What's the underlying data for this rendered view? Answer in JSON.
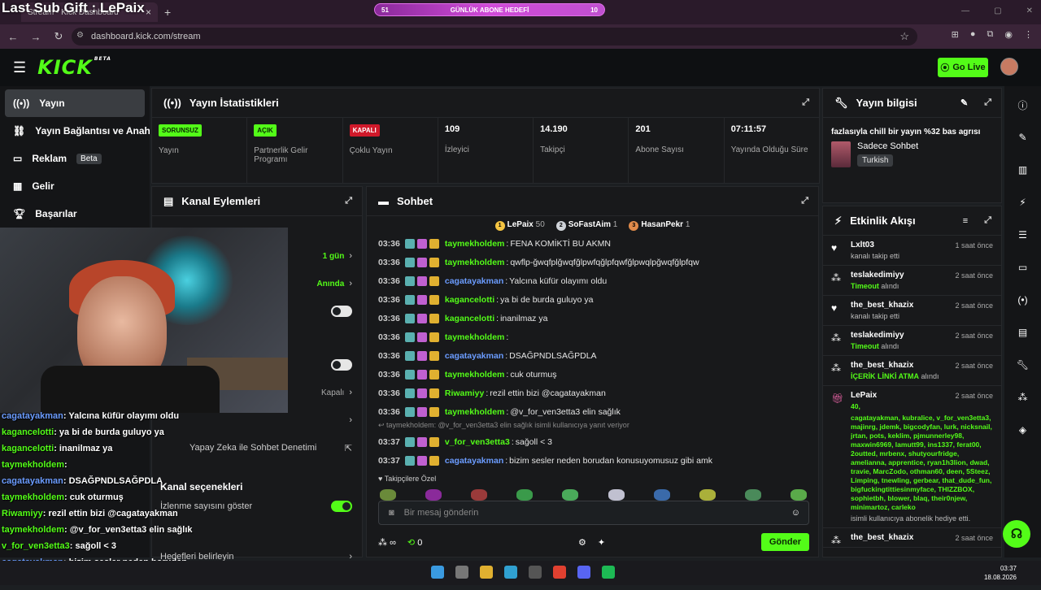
{
  "overlay_title": "Last Sub Gift : LePaix",
  "browser": {
    "tab_title": "Stream - Kick Dashboard",
    "new_tab": "+",
    "goal_left": "51",
    "goal_label": "GÜNLÜK ABONE HEDEFİ",
    "goal_right": "10",
    "url": "dashboard.kick.com/stream"
  },
  "header": {
    "logo": "KICK",
    "logo_badge": "BETA",
    "go_live": "Go Live"
  },
  "nav": {
    "items": [
      {
        "label": "Yayın",
        "icon": "stream-icon"
      },
      {
        "label": "Yayın Bağlantısı ve Anahtarı",
        "icon": "link-icon"
      },
      {
        "label": "Reklam",
        "icon": "ad-icon",
        "badge": "Beta"
      },
      {
        "label": "Gelir",
        "icon": "revenue-icon"
      },
      {
        "label": "Başarılar",
        "icon": "trophy-icon"
      }
    ]
  },
  "stats": {
    "title": "Yayın İstatistikleri",
    "items": [
      {
        "tag": "SORUNSUZ",
        "tag_color": "green",
        "label": "Yayın"
      },
      {
        "tag": "AÇIK",
        "tag_color": "green",
        "label": "Partnerlik Gelir Programı"
      },
      {
        "tag": "KAPALI",
        "tag_color": "red",
        "label": "Çoklu Yayın"
      },
      {
        "value": "109",
        "label": "İzleyici"
      },
      {
        "value": "14.190",
        "label": "Takipçi"
      },
      {
        "value": "201",
        "label": "Abone Sayısı"
      },
      {
        "value": "07:11:57",
        "label": "Yayında Olduğu Süre"
      }
    ]
  },
  "channel": {
    "title": "Kanal Eylemleri",
    "row1_val": "1 gün",
    "row2_val": "Anında",
    "row5_val": "Kapalı",
    "ai_label": "Yapay Zeka ile Sohbet Denetimi",
    "options_title": "Kanal seçenekleri",
    "viewcount_label": "İzlenme sayısını göster",
    "goals_label": "Hedefleri belirleyin"
  },
  "chat": {
    "title": "Sohbet",
    "top": [
      {
        "rank": "1",
        "name": "LePaix",
        "count": "50",
        "color": "#f5c542"
      },
      {
        "rank": "2",
        "name": "SoFastAim",
        "count": "1",
        "color": "#cfd3d8"
      },
      {
        "rank": "3",
        "name": "HasanPekr",
        "count": "1",
        "color": "#e08a4a"
      }
    ],
    "messages": [
      {
        "time": "03:36",
        "user": "taymekholdem",
        "color": "#53fc18",
        "text": "FENA KOMİKTİ BU AKMN"
      },
      {
        "time": "03:36",
        "user": "taymekholdem",
        "color": "#53fc18",
        "text": "qwflp-ğwqfplğwqfğlpwfqğlpfqwfğlpwqlpğwqfğlpfqw"
      },
      {
        "time": "03:36",
        "user": "cagatayakman",
        "color": "#6b9cff",
        "text": "Yalcına küfür olayımı oldu"
      },
      {
        "time": "03:36",
        "user": "kagancelotti",
        "color": "#53fc18",
        "text": "ya bi de burda guluyo ya"
      },
      {
        "time": "03:36",
        "user": "kagancelotti",
        "color": "#53fc18",
        "text": "inanilmaz ya"
      },
      {
        "time": "03:36",
        "user": "taymekholdem",
        "color": "#53fc18",
        "text": ""
      },
      {
        "time": "03:36",
        "user": "cagatayakman",
        "color": "#6b9cff",
        "text": "DSAĞPNDLSAĞPDLA"
      },
      {
        "time": "03:36",
        "user": "taymekholdem",
        "color": "#53fc18",
        "text": "cuk oturmuş"
      },
      {
        "time": "03:36",
        "user": "Riwamiyy",
        "color": "#53fc18",
        "text": "rezil ettin bizi @cagatayakman"
      },
      {
        "time": "03:36",
        "user": "taymekholdem",
        "color": "#53fc18",
        "text": "@v_for_ven3etta3 elin sağlık"
      }
    ],
    "reply_hint": "taymekholdem: @v_for_ven3etta3 elin sağlık isimli kullanıcıya yanıt veriyor",
    "messages2": [
      {
        "time": "03:37",
        "user": "v_for_ven3etta3",
        "color": "#53fc18",
        "text": "sağoll < 3"
      },
      {
        "time": "03:37",
        "user": "cagatayakman",
        "color": "#6b9cff",
        "text": "bizim sesler neden borudan konusuyomusuz gibi amk"
      }
    ],
    "followers_label": "Takipçilere Özel",
    "input_placeholder": "Bir mesaj gönderin",
    "points": "∞",
    "count": "0",
    "send": "Gönder"
  },
  "info": {
    "title": "Yayın bilgisi",
    "stream_title": "fazlasıyla chill bir yayın %32 bas agrısı",
    "category": "Sadece Sohbet",
    "language": "Turkish"
  },
  "activity": {
    "title": "Etkinlik Akışı",
    "items": [
      {
        "icon": "heart-icon",
        "name": "Lxlt03",
        "time": "1 saat önce",
        "desc": "kanalı takip etti",
        "highlight": ""
      },
      {
        "icon": "moderation-icon",
        "name": "teslakedimiyy",
        "time": "2 saat önce",
        "desc": "alındı",
        "highlight": "Timeout"
      },
      {
        "icon": "heart-icon",
        "name": "the_best_khazix",
        "time": "2 saat önce",
        "desc": "kanalı takip etti",
        "highlight": ""
      },
      {
        "icon": "moderation-icon",
        "name": "teslakedimiyy",
        "time": "2 saat önce",
        "desc": "alındı",
        "highlight": "Timeout"
      },
      {
        "icon": "moderation-icon",
        "name": "the_best_khazix",
        "time": "2 saat önce",
        "desc": "alındı",
        "highlight": "İÇERİK LİNKİ ATMA"
      }
    ],
    "gift": {
      "name": "LePaix",
      "time": "2 saat önce",
      "count": "40,",
      "users": "cagatayakman, kubralice, v_for_ven3etta3, majinrg, jdemk, bigcodyfan, lurk, nicksnail, jrtan, pots, keklim, pjmunnerley98, maxwin6969, lamutt99, ins1337, ferat00, 2outted, mrbenx, shutyourfridge, amelianna, apprentice, ryan1h3lion, dwad, travie, MarcZodo, othman60, deen, 5Steez, Limping, tnewling, gerbear, that_dude_fun, bigfuckingtittiesinmyface, THIZZBOX, sophietbh, blower, blaq, their0njew, minimartoz, carleko",
      "suffix": "isimli kullanıcıya abonelik hediye etti."
    },
    "last": {
      "name": "the_best_khazix",
      "time": "2 saat önce"
    }
  },
  "overlay_chat": [
    {
      "user": "cagatayakman",
      "text": "Yalcına küfür olayımı oldu"
    },
    {
      "user": "kagancelotti",
      "text": "ya bi de burda guluyo ya"
    },
    {
      "user": "kagancelotti",
      "text": "inanilmaz ya"
    },
    {
      "user": "taymekholdem",
      "text": ""
    },
    {
      "user": "cagatayakman",
      "text": "DSAĞPNDLSAĞPDLA"
    },
    {
      "user": "taymekholdem",
      "text": "cuk oturmuş"
    },
    {
      "user": "Riwamiyy",
      "text": "rezil ettin bizi @cagatayakman"
    },
    {
      "user": "taymekholdem",
      "text": "@v_for_ven3etta3 elin sağlık"
    },
    {
      "user": "v_for_ven3etta3",
      "text": "sağoll < 3"
    },
    {
      "user": "cagatayakman",
      "text": "bizim sesler neden borudan"
    }
  ],
  "overlay_chat_tail": "konusuyomusuz gibi amk",
  "taskbar": {
    "time": "03:37",
    "date": "18.08.2026"
  },
  "colors": {
    "accent": "#53fc18",
    "bg": "#1c1f22",
    "panel": "#18191b",
    "red": "#d0192a"
  }
}
